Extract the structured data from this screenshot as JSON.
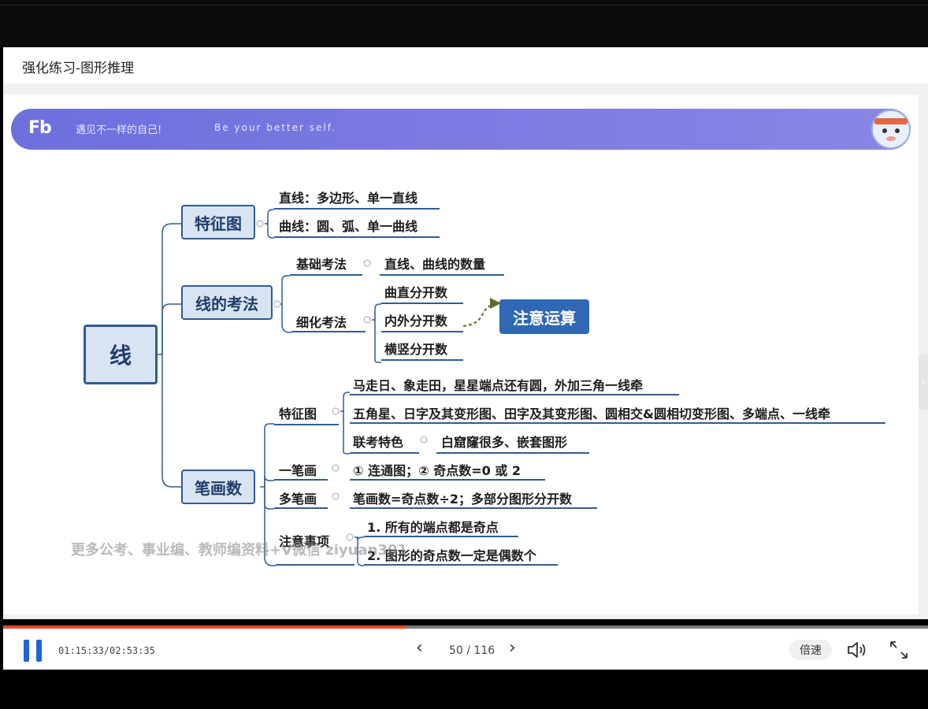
{
  "title": "强化练习-图形推理",
  "banner": {
    "logo": "Fb",
    "slogan_cn": "遇见不一样的自己!",
    "slogan_en": "Be your better self."
  },
  "mindmap": {
    "root": "线",
    "branches": [
      {
        "label": "特征图",
        "items": [
          "直线：多边形、单一直线",
          "曲线：圆、弧、单一曲线"
        ]
      },
      {
        "label": "线的考法",
        "basic": {
          "label": "基础考法",
          "value": "直线、曲线的数量"
        },
        "detail": {
          "label": "细化考法",
          "items": [
            "曲直分开数",
            "内外分开数",
            "横竖分开数"
          ]
        },
        "note": "注意运算"
      },
      {
        "label": "笔画数",
        "feature": {
          "label": "特征图",
          "items": [
            "马走日、象走田，星星端点还有圆，外加三角一线牵",
            "五角星、日字及其变形图、田字及其变形图、圆相交&圆相切变形图、多端点、一线牵"
          ],
          "joint": {
            "label": "联考特色",
            "value": "白窟窿很多、嵌套图形"
          }
        },
        "one_stroke": {
          "label": "一笔画",
          "value": "① 连通图；② 奇点数=0 或 2"
        },
        "multi_stroke": {
          "label": "多笔画",
          "value": "笔画数=奇点数÷2；多部分图形分开数"
        },
        "attention": {
          "label": "注意事项",
          "items": [
            "1. 所有的端点都是奇点",
            "2. 图形的奇点数一定是偶数个"
          ]
        }
      }
    ]
  },
  "watermark": "更多公考、事业编、教师编资料+V微信 ziyuan301",
  "player": {
    "time": "01:15:33/02:53:35",
    "progress": 0.435,
    "page": "50 / 116",
    "speed_label": "倍速",
    "icons": {
      "pause": "pause-icon",
      "prev": "chevron-left-icon",
      "next": "chevron-right-icon",
      "volume": "volume-icon",
      "fullscreen": "fullscreen-icon"
    },
    "accent": "#1f64d8",
    "progress_color": "#e64b24"
  }
}
